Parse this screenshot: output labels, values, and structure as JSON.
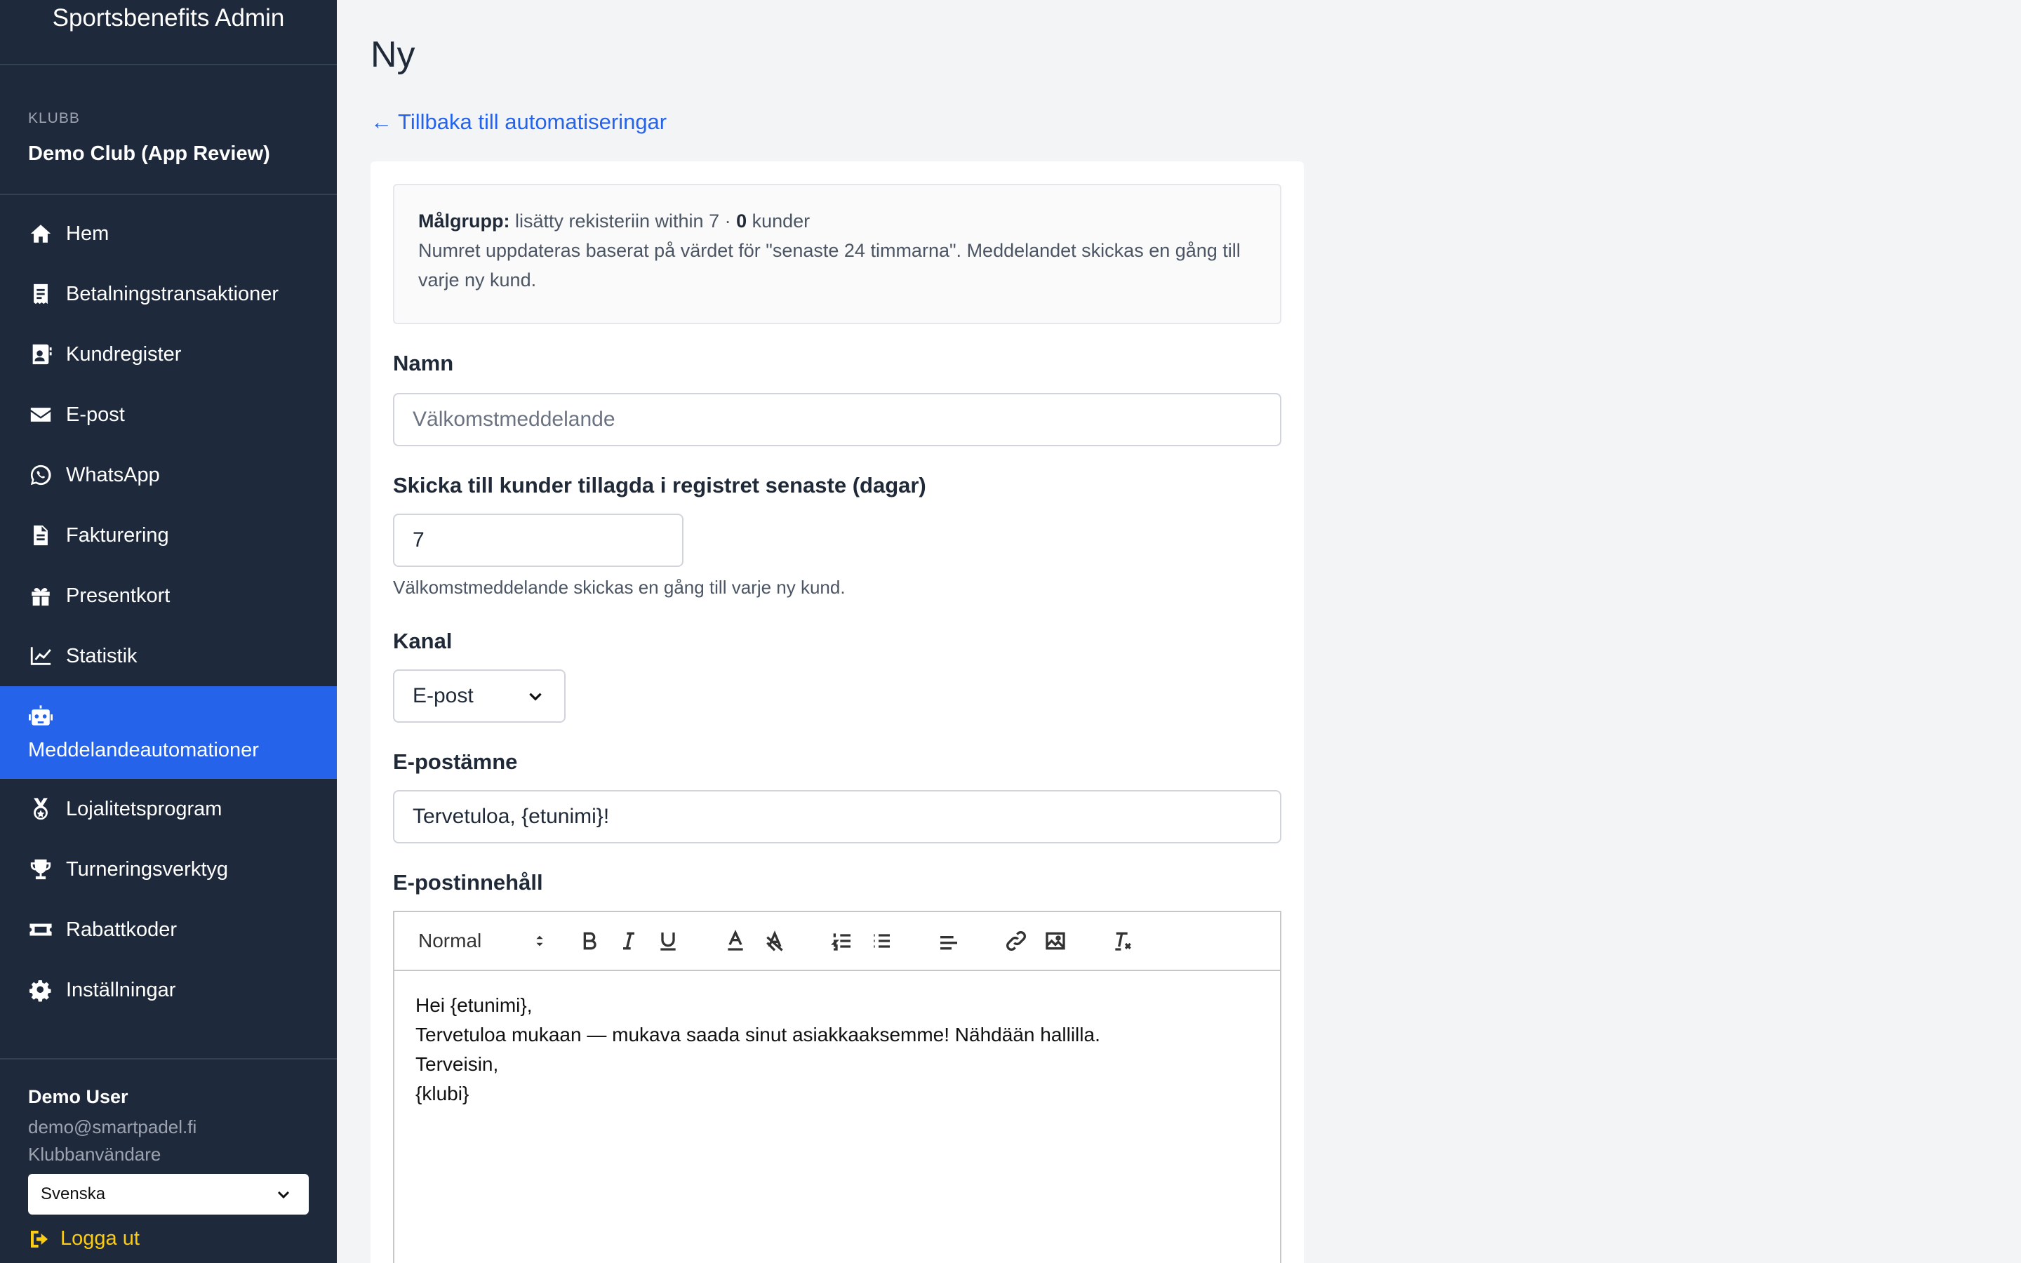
{
  "app": {
    "title": "Sportsbenefits Admin"
  },
  "club": {
    "label": "KLUBB",
    "name": "Demo Club (App Review)"
  },
  "nav": [
    {
      "label": "Hem",
      "icon": "home-icon"
    },
    {
      "label": "Betalningstransaktioner",
      "icon": "receipt-icon"
    },
    {
      "label": "Kundregister",
      "icon": "contact-card-icon"
    },
    {
      "label": "E-post",
      "icon": "envelope-icon"
    },
    {
      "label": "WhatsApp",
      "icon": "whatsapp-icon"
    },
    {
      "label": "Fakturering",
      "icon": "invoice-icon"
    },
    {
      "label": "Presentkort",
      "icon": "gift-icon"
    },
    {
      "label": "Statistik",
      "icon": "chart-line-icon"
    },
    {
      "label": "Meddelandeautomationer",
      "icon": "robot-icon",
      "active": true
    },
    {
      "label": "Lojalitetsprogram",
      "icon": "medal-icon"
    },
    {
      "label": "Turneringsverktyg",
      "icon": "trophy-icon"
    },
    {
      "label": "Rabattkoder",
      "icon": "ticket-icon"
    },
    {
      "label": "Inställningar",
      "icon": "gear-icon"
    }
  ],
  "user": {
    "name": "Demo User",
    "email": "demo@smartpadel.fi",
    "role": "Klubbanvändare",
    "language": "Svenska",
    "logout": "Logga ut"
  },
  "page": {
    "title": "Ny",
    "back_link": "← Tillbaka till automatiseringar"
  },
  "audience": {
    "label": "Målgrupp:",
    "text": " lisätty rekisteriin within 7 · ",
    "count": "0",
    "count_suffix": " kunder",
    "note": "Numret uppdateras baserat på värdet för \"senaste 24 timmarna\". Meddelandet skickas en gång till varje ny kund."
  },
  "form": {
    "name_label": "Namn",
    "name_placeholder": "Välkomstmeddelande",
    "days_label": "Skicka till kunder tillagda i registret senaste (dagar)",
    "days_value": "7",
    "days_help": "Välkomstmeddelande skickas en gång till varje ny kund.",
    "channel_label": "Kanal",
    "channel_value": "E-post",
    "subject_label": "E-postämne",
    "subject_value": "Tervetuloa, {etunimi}!",
    "content_label": "E-postinnehåll"
  },
  "editor": {
    "format": "Normal",
    "lines": [
      "Hei {etunimi},",
      "Tervetuloa mukaan — mukava saada sinut asiakkaaksemme! Nähdään hallilla.",
      "Terveisin,",
      "{klubi}"
    ]
  },
  "colors": {
    "sidebar_bg": "#1e293b",
    "active_bg": "#2563eb",
    "link": "#2563eb",
    "logout": "#facc15"
  }
}
